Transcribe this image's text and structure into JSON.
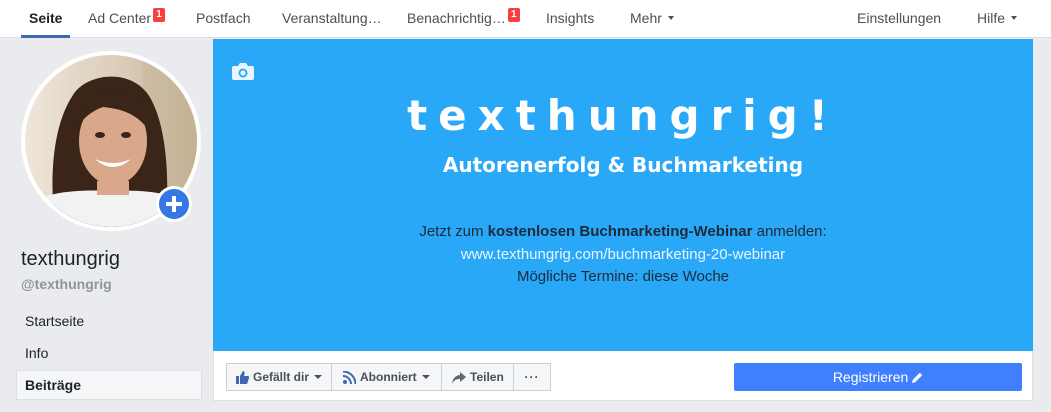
{
  "nav": {
    "tabs": [
      {
        "label": "Seite"
      },
      {
        "label": "Ad Center",
        "badge": "1"
      },
      {
        "label": "Postfach"
      },
      {
        "label": "Veranstaltung…"
      },
      {
        "label": "Benachrichtig…",
        "badge": "1"
      },
      {
        "label": "Insights"
      },
      {
        "label": "Mehr"
      }
    ],
    "settings_label": "Einstellungen",
    "help_label": "Hilfe"
  },
  "profile": {
    "name": "texthungrig",
    "handle": "@texthungrig"
  },
  "sidebar": {
    "items": [
      {
        "label": "Startseite"
      },
      {
        "label": "Info"
      },
      {
        "label": "Beiträge"
      }
    ]
  },
  "cover": {
    "title": "texthungrig!",
    "subtitle": "Autorenerfolg & Buchmarketing",
    "line1_prefix": "Jetzt zum",
    "line1_bold": "kostenlosen Buchmarketing-Webinar",
    "line1_suffix": "anmelden:",
    "line2": "www.texthungrig.com/buchmarketing-20-webinar",
    "line3": "Mögliche Termine: diese Woche",
    "background_color": "#2aa8f8"
  },
  "actions": {
    "like_label": "Gefällt dir",
    "follow_label": "Abonniert",
    "share_label": "Teilen",
    "more_label": "···",
    "register_label": "Registrieren"
  },
  "colors": {
    "accent": "#4267b2",
    "badge": "#fa3e3e",
    "register_button": "#4080ff"
  }
}
